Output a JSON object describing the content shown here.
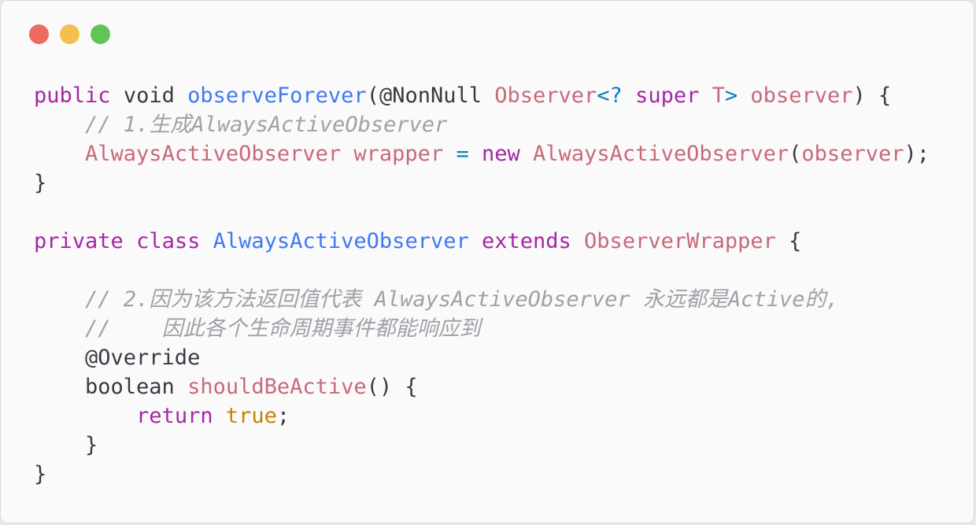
{
  "window": {
    "controls": [
      {
        "name": "close",
        "icon": "close-dot-icon",
        "color": "#ec6a5e"
      },
      {
        "name": "minimize",
        "icon": "minimize-dot-icon",
        "color": "#f4bf4f"
      },
      {
        "name": "zoom",
        "icon": "zoom-dot-icon",
        "color": "#61c554"
      }
    ]
  },
  "theme": {
    "keyword": "#a626a4",
    "function": "#4078f2",
    "type": "#c8697a",
    "operator": "#0184bc",
    "literal": "#c18401",
    "comment": "#a0a1a7",
    "plain": "#383a42"
  },
  "code": {
    "lines": [
      [
        {
          "t": "kw",
          "v": "public"
        },
        {
          "t": "pl",
          "v": " "
        },
        {
          "t": "pl",
          "v": "void"
        },
        {
          "t": "pl",
          "v": " "
        },
        {
          "t": "fn",
          "v": "observeForever"
        },
        {
          "t": "pl",
          "v": "(@NonNull "
        },
        {
          "t": "ty",
          "v": "Observer"
        },
        {
          "t": "op",
          "v": "<?"
        },
        {
          "t": "pl",
          "v": " "
        },
        {
          "t": "kw",
          "v": "super"
        },
        {
          "t": "pl",
          "v": " "
        },
        {
          "t": "ty",
          "v": "T"
        },
        {
          "t": "op",
          "v": ">"
        },
        {
          "t": "pl",
          "v": " "
        },
        {
          "t": "ty",
          "v": "observer"
        },
        {
          "t": "pl",
          "v": ") {"
        }
      ],
      [
        {
          "t": "pl",
          "v": "    "
        },
        {
          "t": "cm",
          "v": "// 1.生成AlwaysActiveObserver"
        }
      ],
      [
        {
          "t": "pl",
          "v": "    "
        },
        {
          "t": "ty",
          "v": "AlwaysActiveObserver"
        },
        {
          "t": "pl",
          "v": " "
        },
        {
          "t": "ty",
          "v": "wrapper"
        },
        {
          "t": "pl",
          "v": " "
        },
        {
          "t": "op",
          "v": "="
        },
        {
          "t": "pl",
          "v": " "
        },
        {
          "t": "kw",
          "v": "new"
        },
        {
          "t": "pl",
          "v": " "
        },
        {
          "t": "ty",
          "v": "AlwaysActiveObserver"
        },
        {
          "t": "pl",
          "v": "("
        },
        {
          "t": "ty",
          "v": "observer"
        },
        {
          "t": "pl",
          "v": ");"
        }
      ],
      [
        {
          "t": "pl",
          "v": "}"
        }
      ],
      [],
      [
        {
          "t": "kw",
          "v": "private"
        },
        {
          "t": "pl",
          "v": " "
        },
        {
          "t": "kw",
          "v": "class"
        },
        {
          "t": "pl",
          "v": " "
        },
        {
          "t": "fn",
          "v": "AlwaysActiveObserver"
        },
        {
          "t": "pl",
          "v": " "
        },
        {
          "t": "kw",
          "v": "extends"
        },
        {
          "t": "pl",
          "v": " "
        },
        {
          "t": "ty",
          "v": "ObserverWrapper"
        },
        {
          "t": "pl",
          "v": " {"
        }
      ],
      [],
      [
        {
          "t": "pl",
          "v": "    "
        },
        {
          "t": "cm",
          "v": "// 2.因为该方法返回值代表 AlwaysActiveObserver 永远都是Active的,"
        }
      ],
      [
        {
          "t": "pl",
          "v": "    "
        },
        {
          "t": "cm",
          "v": "//    因此各个生命周期事件都能响应到"
        }
      ],
      [
        {
          "t": "pl",
          "v": "    @Override"
        }
      ],
      [
        {
          "t": "pl",
          "v": "    boolean "
        },
        {
          "t": "ty",
          "v": "shouldBeActive"
        },
        {
          "t": "pl",
          "v": "() {"
        }
      ],
      [
        {
          "t": "pl",
          "v": "        "
        },
        {
          "t": "kw",
          "v": "return"
        },
        {
          "t": "pl",
          "v": " "
        },
        {
          "t": "lit",
          "v": "true"
        },
        {
          "t": "pl",
          "v": ";"
        }
      ],
      [
        {
          "t": "pl",
          "v": "    }"
        }
      ],
      [
        {
          "t": "pl",
          "v": "}"
        }
      ]
    ]
  }
}
